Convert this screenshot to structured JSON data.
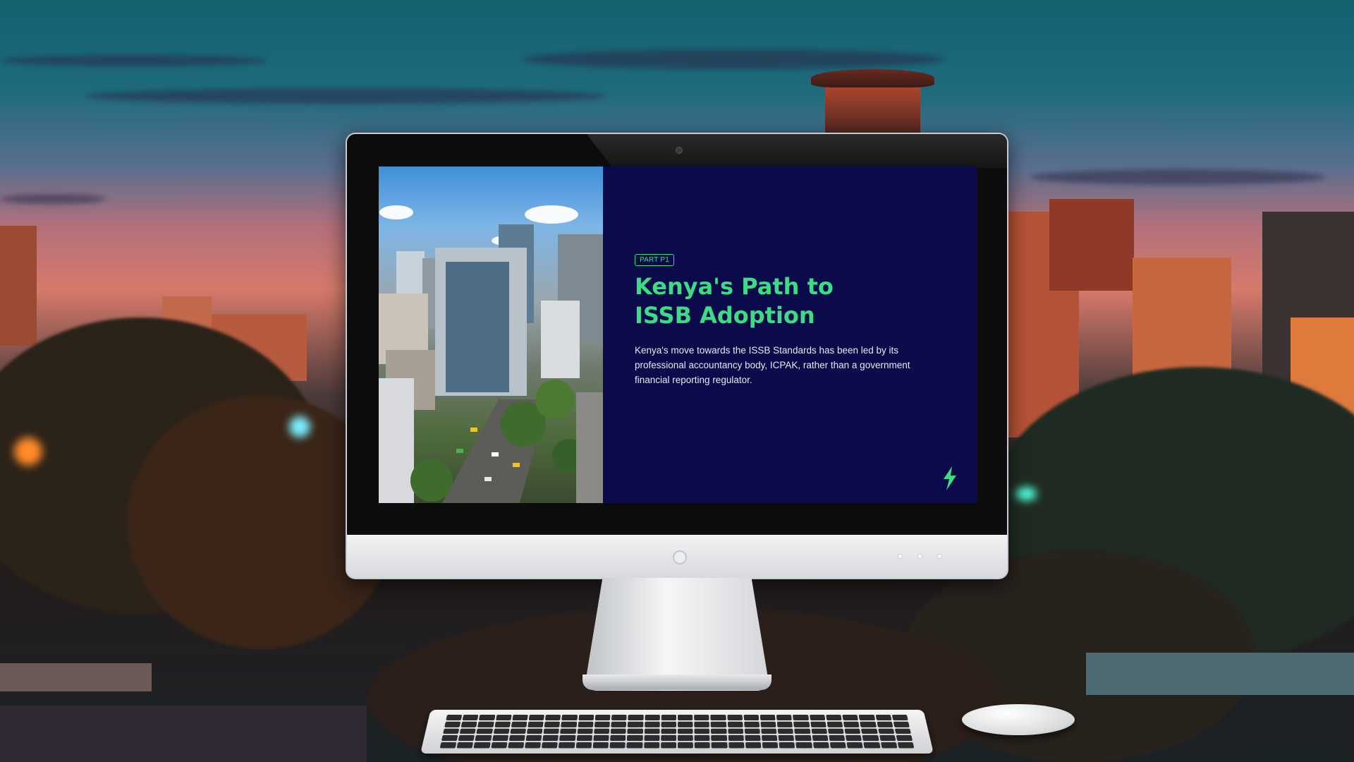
{
  "slide": {
    "badge": "PART P1",
    "title": "Kenya's Path to ISSB Adoption",
    "body": "Kenya's move towards the ISSB Standards has been led by its professional accountancy body, ICPAK, rather than a government financial reporting regulator.",
    "accent_color": "#3ddc84",
    "background_color": "#0b0a4a",
    "logo_icon": "lightning-bolt-icon"
  },
  "photo": {
    "icon": "city-aerial-photo"
  }
}
